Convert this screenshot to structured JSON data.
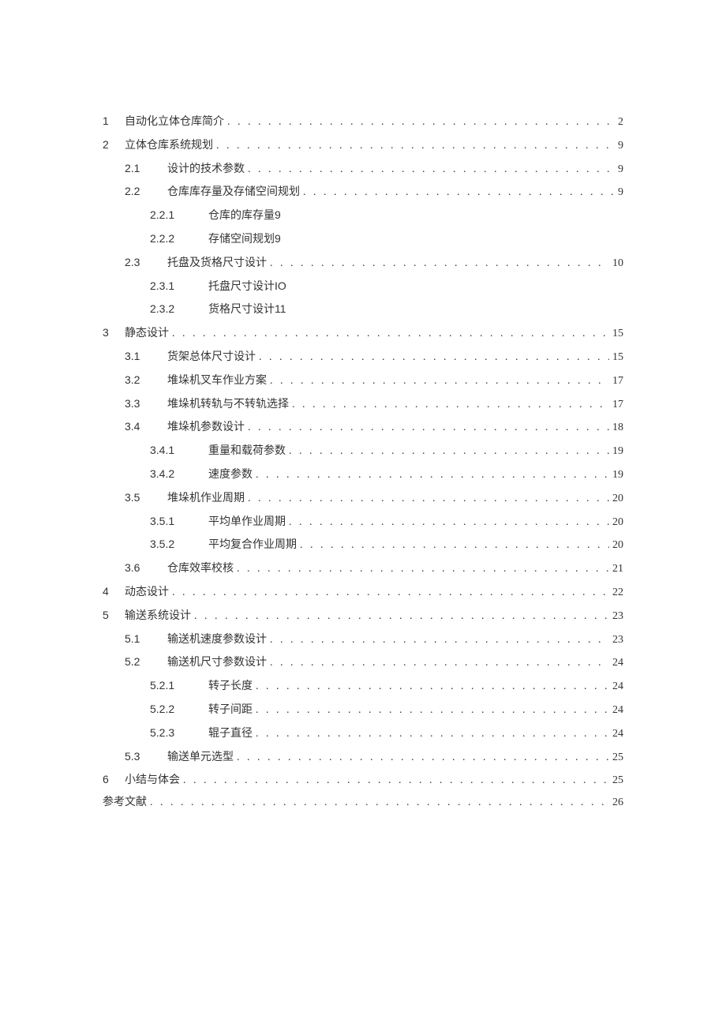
{
  "toc": [
    {
      "level": 1,
      "num": "1",
      "title": "自动化立体仓库简介",
      "page": "2",
      "dots": true
    },
    {
      "level": 1,
      "num": "2",
      "title": "立体仓库系统规划",
      "page": "9",
      "dots": true
    },
    {
      "level": 2,
      "num": "2.1",
      "title": "设计的技术参数",
      "page": "9",
      "dots": true
    },
    {
      "level": 2,
      "num": "2.2",
      "title": "仓库库存量及存储空间规划",
      "page": "9",
      "dots": true
    },
    {
      "level": 3,
      "num": "2.2.1",
      "title": "仓库的库存量",
      "page": "9",
      "dots": false
    },
    {
      "level": 3,
      "num": "2.2.2",
      "title": "存储空间规划",
      "page": "9",
      "dots": false
    },
    {
      "level": 2,
      "num": "2.3",
      "title": "托盘及货格尺寸设计",
      "page": "10",
      "dots": true
    },
    {
      "level": 3,
      "num": "2.3.1",
      "title": "托盘尺寸设计",
      "page": "IO",
      "dots": false
    },
    {
      "level": 3,
      "num": "2.3.2",
      "title": "货格尺寸设计",
      "page": "11",
      "dots": false
    },
    {
      "level": 1,
      "num": "3",
      "title": "静态设计",
      "page": "15",
      "dots": true
    },
    {
      "level": 2,
      "num": "3.1",
      "title": "货架总体尺寸设计",
      "page": "15",
      "dots": true
    },
    {
      "level": 2,
      "num": "3.2",
      "title": "堆垛机叉车作业方案",
      "page": "17",
      "dots": true
    },
    {
      "level": 2,
      "num": "3.3",
      "title": "堆垛机转轨与不转轨选择",
      "page": "17",
      "dots": true
    },
    {
      "level": 2,
      "num": "3.4",
      "title": "堆垛机参数设计",
      "page": "18",
      "dots": true
    },
    {
      "level": 3,
      "num": "3.4.1",
      "title": "重量和载荷参数",
      "page": "19",
      "dots": true
    },
    {
      "level": 3,
      "num": "3.4.2",
      "title": "速度参数",
      "page": "19",
      "dots": true
    },
    {
      "level": 2,
      "num": "3.5",
      "title": "堆垛机作业周期",
      "page": "20",
      "dots": true
    },
    {
      "level": 3,
      "num": "3.5.1",
      "title": "平均单作业周期",
      "page": "20",
      "dots": true
    },
    {
      "level": 3,
      "num": "3.5.2",
      "title": "平均复合作业周期",
      "page": "20",
      "dots": true
    },
    {
      "level": 2,
      "num": "3.6",
      "title": "仓库效率校核",
      "page": "21",
      "dots": true
    },
    {
      "level": 1,
      "num": "4",
      "title": "动态设计",
      "page": "22",
      "dots": true
    },
    {
      "level": 1,
      "num": "5",
      "title": "输送系统设计",
      "page": "23",
      "dots": true
    },
    {
      "level": 2,
      "num": "5.1",
      "title": "输送机速度参数设计",
      "page": "23",
      "dots": true
    },
    {
      "level": 2,
      "num": "5.2",
      "title": "输送机尺寸参数设计",
      "page": "24",
      "dots": true
    },
    {
      "level": 3,
      "num": "5.2.1",
      "title": "转子长度",
      "page": "24",
      "dots": true
    },
    {
      "level": 3,
      "num": "5.2.2",
      "title": "转子间距",
      "page": "24",
      "dots": true
    },
    {
      "level": 3,
      "num": "5.2.3",
      "title": "辊子直径",
      "page": "24",
      "dots": true
    },
    {
      "level": 2,
      "num": "5.3",
      "title": "输送单元选型",
      "page": "25",
      "dots": true
    },
    {
      "level": 1,
      "num": "6",
      "title": "小结与体会",
      "page": "25",
      "dots": true
    },
    {
      "level": 0,
      "num": "",
      "title": "参考文献",
      "page": "26",
      "dots": true
    }
  ]
}
